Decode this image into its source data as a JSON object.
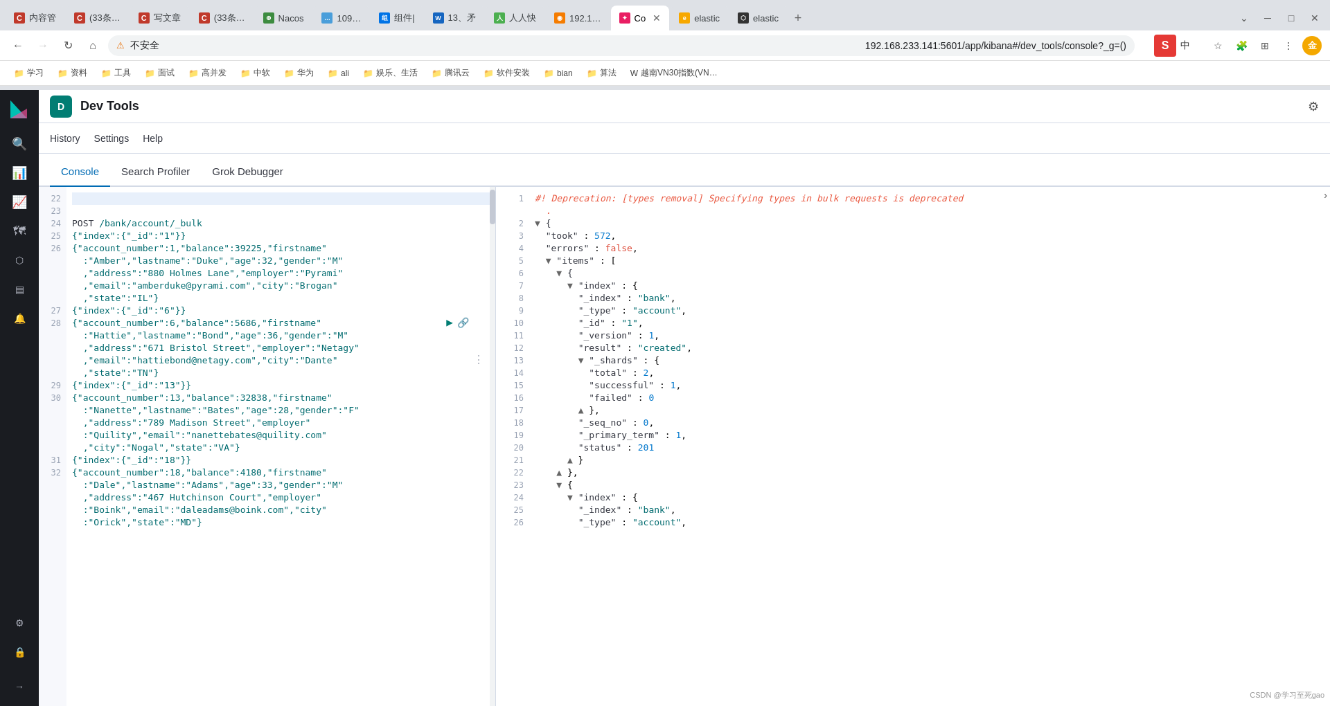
{
  "browser": {
    "tabs": [
      {
        "id": "tab1",
        "favicon_color": "#c0392b",
        "favicon_label": "C",
        "title": "内容管",
        "active": false
      },
      {
        "id": "tab2",
        "favicon_color": "#c0392b",
        "favicon_label": "C",
        "title": "(33条…",
        "active": false
      },
      {
        "id": "tab3",
        "favicon_color": "#c0392b",
        "favicon_label": "C",
        "title": "写文章",
        "active": false
      },
      {
        "id": "tab4",
        "favicon_color": "#c0392b",
        "favicon_label": "C",
        "title": "(33条…",
        "active": false
      },
      {
        "id": "tab5",
        "favicon_color": "#3d8c40",
        "favicon_label": "⊕",
        "title": "Nacos",
        "active": false
      },
      {
        "id": "tab6",
        "favicon_color": "#4a9eda",
        "favicon_label": "…",
        "title": "109…",
        "active": false
      },
      {
        "id": "tab7",
        "favicon_color": "#0073e6",
        "favicon_label": "组",
        "title": "组件|",
        "active": false
      },
      {
        "id": "tab8",
        "favicon_color": "#1565c0",
        "favicon_label": "W",
        "title": "13、矛",
        "active": false
      },
      {
        "id": "tab9",
        "favicon_color": "#4caf50",
        "favicon_label": "人",
        "title": "人人快",
        "active": false
      },
      {
        "id": "tab10",
        "favicon_color": "#f57c00",
        "favicon_label": "◉",
        "title": "192.1…",
        "active": false
      },
      {
        "id": "tab11",
        "favicon_color": "#e91e63",
        "favicon_label": "✦",
        "title": "Co",
        "active": true,
        "close": true
      },
      {
        "id": "tab12",
        "favicon_color": "#f7a800",
        "favicon_label": "e",
        "title": "elastic",
        "active": false
      },
      {
        "id": "tab13",
        "favicon_color": "#333",
        "favicon_label": "⬡",
        "title": "elastic",
        "active": false
      }
    ],
    "address": "192.168.233.141:5601/app/kibana#/dev_tools/console?_g=()",
    "security_warning": "不安全",
    "bookmarks": [
      "学习",
      "资料",
      "工具",
      "面试",
      "高并发",
      "中软",
      "华为",
      "ali",
      "娱乐、生活",
      "腾讯云",
      "软件安装",
      "bian",
      "算法",
      "越南VN30指数(VN…"
    ]
  },
  "kibana": {
    "title": "Dev Tools",
    "app_icon_letter": "D",
    "top_nav": [
      "History",
      "Settings",
      "Help"
    ],
    "tabs": [
      "Console",
      "Search Profiler",
      "Grok Debugger"
    ],
    "active_tab": "Console"
  },
  "sidebar": {
    "icons": [
      {
        "id": "home",
        "symbol": "🏠"
      },
      {
        "id": "discover",
        "symbol": "🔍"
      },
      {
        "id": "dashboard",
        "symbol": "📊"
      },
      {
        "id": "visualize",
        "symbol": "📈"
      },
      {
        "id": "maps",
        "symbol": "🗺"
      },
      {
        "id": "ml",
        "symbol": "🧠"
      },
      {
        "id": "stack",
        "symbol": "📦"
      },
      {
        "id": "alerts",
        "symbol": "🔔"
      },
      {
        "id": "dev_tools",
        "symbol": "⚙"
      },
      {
        "id": "management",
        "symbol": "🔒"
      },
      {
        "id": "collapse",
        "symbol": "→"
      }
    ]
  },
  "editor": {
    "left": {
      "lines": [
        {
          "num": "22",
          "content": "",
          "selected": true
        },
        {
          "num": "23",
          "content": ""
        },
        {
          "num": "24",
          "content": "POST /bank/account/_bulk"
        },
        {
          "num": "25",
          "content": "{\"index\":{\"_id\":\"1\"}}"
        },
        {
          "num": "26",
          "content": "{\"account_number\":1,\"balance\":39225,\"firstname\""
        },
        {
          "num": "",
          "content": "  :\"Amber\",\"lastname\":\"Duke\",\"age\":32,\"gender\":\"M\""
        },
        {
          "num": "",
          "content": "  ,\"address\":\"880 Holmes Lane\",\"employer\":\"Pyrami\""
        },
        {
          "num": "",
          "content": "  ,\"email\":\"amberduke@pyrami.com\",\"city\":\"Brogan\""
        },
        {
          "num": "",
          "content": "  ,\"state\":\"IL\"}"
        },
        {
          "num": "27",
          "content": "{\"index\":{\"_id\":\"6\"}}"
        },
        {
          "num": "28",
          "content": "{\"account_number\":6,\"balance\":5686,\"firstname\""
        },
        {
          "num": "",
          "content": "  :\"Hattie\",\"lastname\":\"Bond\",\"age\":36,\"gender\":\"M\""
        },
        {
          "num": "",
          "content": "  ,\"address\":\"671 Bristol Street\",\"employer\":\"Netagy\""
        },
        {
          "num": "",
          "content": "  ,\"email\":\"hattiebond@netagy.com\",\"city\":\"Dante\""
        },
        {
          "num": "",
          "content": "  ,\"state\":\"TN\"}"
        },
        {
          "num": "29",
          "content": "{\"index\":{\"_id\":\"13\"}}"
        },
        {
          "num": "30",
          "content": "{\"account_number\":13,\"balance\":32838,\"firstname\""
        },
        {
          "num": "",
          "content": "  :\"Nanette\",\"lastname\":\"Bates\",\"age\":28,\"gender\":\"F\""
        },
        {
          "num": "",
          "content": "  ,\"address\":\"789 Madison Street\",\"employer\""
        },
        {
          "num": "",
          "content": "  :\"Quility\",\"email\":\"nanettebates@quility.com\""
        },
        {
          "num": "",
          "content": "  ,\"city\":\"Nogal\",\"state\":\"VA\"}"
        },
        {
          "num": "31",
          "content": "{\"index\":{\"_id\":\"18\"}}"
        },
        {
          "num": "32",
          "content": "{\"account_number\":18,\"balance\":4180,\"firstname\""
        },
        {
          "num": "",
          "content": "  :\"Dale\",\"lastname\":\"Adams\",\"age\":33,\"gender\":\"M\""
        },
        {
          "num": "",
          "content": "  ,\"address\":\"467 Hutchinson Court\",\"employer\""
        },
        {
          "num": "",
          "content": "  :\"Boink\",\"email\":\"daleadams@boink.com\",\"city\""
        },
        {
          "num": "",
          "content": "  :\"Orick\",\"state\":\"MD\"}"
        }
      ]
    },
    "right": {
      "lines": [
        {
          "num": "1",
          "content": "#! Deprecation: [types removal] Specifying types in bulk requests is deprecated",
          "type": "comment",
          "indent": 0
        },
        {
          "num": "",
          "content": "  .",
          "type": "comment",
          "indent": 2
        },
        {
          "num": "2",
          "content": "{",
          "type": "brace",
          "arrow": "▼"
        },
        {
          "num": "3",
          "content": "  \"took\" : 572,",
          "type": "normal"
        },
        {
          "num": "4",
          "content": "  \"errors\" : false,",
          "type": "normal"
        },
        {
          "num": "5",
          "content": "  \"items\" : [",
          "type": "normal",
          "arrow": "▼"
        },
        {
          "num": "6",
          "content": "    {",
          "type": "brace",
          "arrow": "▼"
        },
        {
          "num": "7",
          "content": "      \"index\" : {",
          "type": "normal",
          "arrow": "▼"
        },
        {
          "num": "8",
          "content": "        \"_index\" : \"bank\",",
          "type": "normal"
        },
        {
          "num": "9",
          "content": "        \"_type\" : \"account\",",
          "type": "normal"
        },
        {
          "num": "10",
          "content": "        \"_id\" : \"1\",",
          "type": "normal"
        },
        {
          "num": "11",
          "content": "        \"_version\" : 1,",
          "type": "normal"
        },
        {
          "num": "12",
          "content": "        \"result\" : \"created\",",
          "type": "normal"
        },
        {
          "num": "13",
          "content": "        \"_shards\" : {",
          "type": "normal",
          "arrow": "▼"
        },
        {
          "num": "14",
          "content": "          \"total\" : 2,",
          "type": "normal"
        },
        {
          "num": "15",
          "content": "          \"successful\" : 1,",
          "type": "normal"
        },
        {
          "num": "16",
          "content": "          \"failed\" : 0",
          "type": "normal"
        },
        {
          "num": "17",
          "content": "        },",
          "type": "brace",
          "arrow": "▲"
        },
        {
          "num": "18",
          "content": "        \"_seq_no\" : 0,",
          "type": "normal"
        },
        {
          "num": "19",
          "content": "        \"_primary_term\" : 1,",
          "type": "normal"
        },
        {
          "num": "20",
          "content": "        \"status\" : 201",
          "type": "normal"
        },
        {
          "num": "21",
          "content": "      }",
          "type": "brace",
          "arrow": "▲"
        },
        {
          "num": "22",
          "content": "    },",
          "type": "brace",
          "arrow": "▲"
        },
        {
          "num": "23",
          "content": "    {",
          "type": "brace",
          "arrow": "▼"
        },
        {
          "num": "24",
          "content": "      \"index\" : {",
          "type": "normal",
          "arrow": "▼"
        },
        {
          "num": "25",
          "content": "        \"_index\" : \"bank\",",
          "type": "normal"
        },
        {
          "num": "26",
          "content": "        \"_type\" : \"account\",",
          "type": "normal"
        }
      ]
    }
  },
  "watermark": "CSDN @学习至死gao"
}
